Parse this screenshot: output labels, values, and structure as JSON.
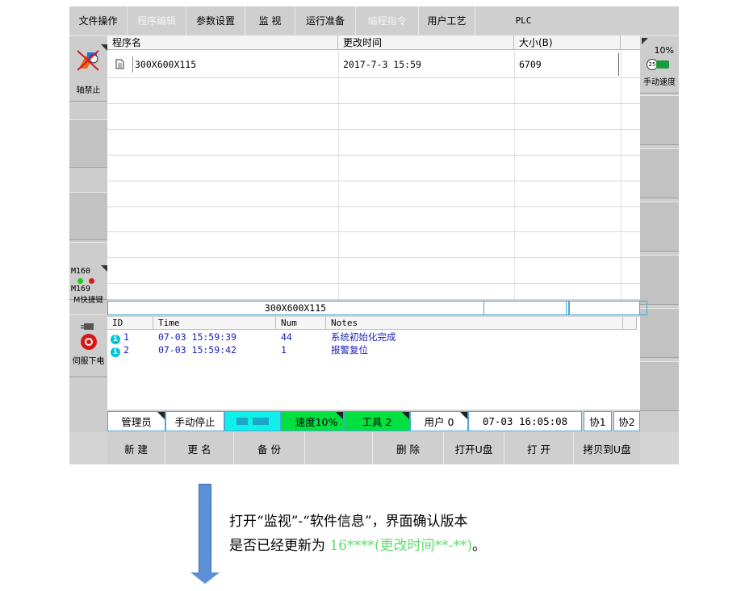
{
  "menu": {
    "tabs": [
      {
        "label": "文件操作",
        "enabled": true
      },
      {
        "label": "程序编辑",
        "enabled": false
      },
      {
        "label": "参数设置",
        "enabled": true
      },
      {
        "label": "监  视",
        "enabled": true
      },
      {
        "label": "运行准备",
        "enabled": true
      },
      {
        "label": "编程指令",
        "enabled": false
      },
      {
        "label": "用户工艺",
        "enabled": true
      },
      {
        "label": "PLC",
        "enabled": true
      }
    ]
  },
  "left_panel": {
    "axis_lock_label": "轴禁止",
    "m_top": "M160",
    "m_bottom": "M169",
    "m_shortcut_label": "M快捷键",
    "servo_off_label": "伺服下电"
  },
  "right_panel": {
    "speed_pct": "10%",
    "speed_value": "25",
    "manual_speed_label": "手动速度"
  },
  "file_table": {
    "headers": [
      "程序名",
      "更改时间",
      "大小(B)"
    ],
    "rows": [
      {
        "name": "300X600X115",
        "time": "2017-7-3 15:59",
        "size": "6709"
      }
    ]
  },
  "info_bar": {
    "current_program": "300X600X115"
  },
  "alarm_log": {
    "headers": [
      "ID",
      "Time",
      "Num",
      "Notes"
    ],
    "rows": [
      {
        "id": "1",
        "time": "07-03 15:59:39",
        "num": "44",
        "notes": "系统初始化完成"
      },
      {
        "id": "2",
        "time": "07-03 15:59:42",
        "num": "1",
        "notes": "报警复位"
      }
    ]
  },
  "status_bar": {
    "user_role": "管理员",
    "stop_mode": "手动停止",
    "speed": "速度10%",
    "tool": "工具 2",
    "user": "用户 0",
    "datetime": "07-03 16:05:08",
    "co1": "协1",
    "co2": "协2"
  },
  "function_keys": [
    "新  建",
    "更  名",
    "备  份",
    "",
    "删  除",
    "打开U盘",
    "打  开",
    "拷贝到U盘"
  ],
  "caption": {
    "line1": "打开“监视”-“软件信息”，界面确认版本",
    "line2_prefix": "是否已经更新为 ",
    "line2_highlight": "16****(更改时间**-**)",
    "line2_suffix": "。"
  },
  "colors": {
    "highlight_text": "#5fdc6d",
    "status_green": "#00e040",
    "status_cyan": "#10f0e8",
    "border_blue": "#49a7d8",
    "arrow_blue": "#5b8fd6"
  }
}
